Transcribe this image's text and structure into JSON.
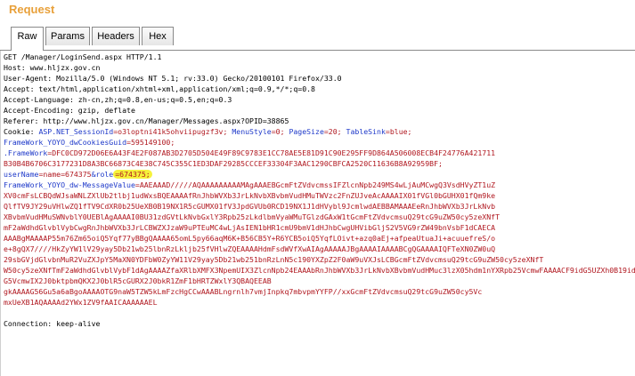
{
  "panel": {
    "title": "Request"
  },
  "tabs": [
    {
      "label": "Raw",
      "active": true
    },
    {
      "label": "Params",
      "active": false
    },
    {
      "label": "Headers",
      "active": false
    },
    {
      "label": "Hex",
      "active": false
    }
  ],
  "request": {
    "request_line": "GET /Manager/LoginSend.aspx HTTP/1.1",
    "host": "Host: www.hljzx.gov.cn",
    "user_agent": "User-Agent: Mozilla/5.0 (Windows NT 5.1; rv:33.0) Gecko/20100101 Firefox/33.0",
    "accept": "Accept: text/html,application/xhtml+xml,application/xml;q=0.9,*/*;q=0.8",
    "accept_language": "Accept-Language: zh-cn,zh;q=0.8,en-us;q=0.5,en;q=0.3",
    "accept_encoding": "Accept-Encoding: gzip, deflate",
    "referer": "Referer: http://www.hljzx.gov.cn/Manager/Messages.aspx?OPID=38865",
    "cookie": {
      "label": "Cookie: ",
      "c1_name": "ASP.NET_SessionId",
      "c1_val": "=o3loptni41k5ohviipugzf3v; ",
      "c2_name": "MenuStyle",
      "c2_val": "=0; ",
      "c3_name": "PageSize",
      "c3_val": "=20; ",
      "c4_name": "TableSink",
      "c4_val": "=blue;",
      "c5_name": "FrameWork_YOYO_dwCookiesGuid",
      "c5_val": "=595149100;",
      "c6_name": ".FrameWork",
      "c6_val": "=DFC0CD972D06E6A43F4E2F087AB3D2705D504E49F89C9783E1CC78AE5E81D91C90E295FF9D864A506008ECB4F24776A421711",
      "c6_cont": "B30B4B6706C3177231D8A3BC66873C4E38C745C355C1ED3DAF29285CCCEF33304F3AAC1290CBFCA2520C11636B8A92959BF;",
      "c7_name": "userName",
      "c7_val": "=name=674375",
      "c7_val2": "&role",
      "c7_highlight": "=674375;",
      "c8_name": "FrameWork_YOYO_dw-MessageValue",
      "c8_val_lines": [
        "=AAEAAAD/////AQAAAAAAAAAMAgAAAEBGcmFtZVdvcmssIFZlcnNpb249MS4wLjAuMCwgQ3VsdHVyZT1uZ",
        "XV0cmFsLCBQdWJsaWNLZXlUb2tlbj1udWxsBQEAAAAfRnJhbWVXb3JrLkNvbXBvbmVudHMuTWVzc2FnZUJveAcAAAAIX01fVGl0bGUHX01fQm9ke",
        "QlfTV9JY29uVHlwZQ1fTV9CdXR0b25UeXB0B19NX1R5cGUMX01fV3JpdGVUb0RCD19NX1J1dHVybl9JcmlwdAEBBAMAAAEeRnJhbWVXb3JrLkNvb",
        "XBvbmVudHMuSWNvblY0UEBlAgAAAAI0BU31zdGVtLkNvbGxlY3Rpb25zLkdlbmVyaWMuTGlzdGAxW1tGcmFtZVdvcmsuQ29tcG9uZW50cy5zeXNfT",
        "mF2aWdhdGlvblVybCwgRnJhbWVXb3JrLCBWZXJzaW9uPTEuMC4wLjAsIEN1bHR1cmU9bmV1dHJhbCwgUHVibGljS2V5VG9rZW49bnVsbF1dCAECA",
        "AAABgMAAAAP55m76Zm65oiQ5Yqf77yBBgQAAAA65omL5py66aqM6K+B56CB5Y+R6YCB5oiQ5YqfLOivt+azq0aEj+afpeaUtuaJi+acuuefreS/o",
        "e+8gQX7////HkZyYW1lV29yay5Db21wb25lbnRzLkljb25fVHlwZQEAAAAHdmFsdWVfXwAIAgAAAAAJBgAAAAIAAAABCgQGAAAAIQFTeXN0ZW0uQ",
        "29sbGVjdGlvbnMuR2VuZXJpY5MaXN0YDFbW0ZyYW11V29yay5Db21wb251bnRzLnN5c190YXZpZ2F0aW9uVXJsLCBGcmFtZVdvcmsuQ29tcG9uZW50cy5zeXNfT",
        "W50cy5zeXNfTmF2aWdhdGlvblVybF1dAgAAAAZfaXRlbXMFX3NpemUIX3ZlcnNpb24EAAAbRnJhbWVXb3JrLkNvbXBvbmVudHMuc3lzX05hdm1nYXRpb25VcmwFAAAACF9idG5UZXh0B19id",
        "G5VcmwIX2J0bktpbmQKX2J0blR5cGURX2J0bkR1ZmF1bHRTZWxlY3QBAQEEAB",
        "gkAAAAG56Gu5a6aBgoAAAAOTG9naW5TZW5kLmFzcHgCCwAAABLngrnlh7vmjInpkq7mbvpmYYFP//xxGcmFtZVdvcmsuQ29tcG9uZW50cy5Vc",
        "mxUeXB1AQAAAAd2YWx1ZV9fAAICAAAAAAEL"
      ]
    },
    "connection": "Connection: keep-alive"
  }
}
